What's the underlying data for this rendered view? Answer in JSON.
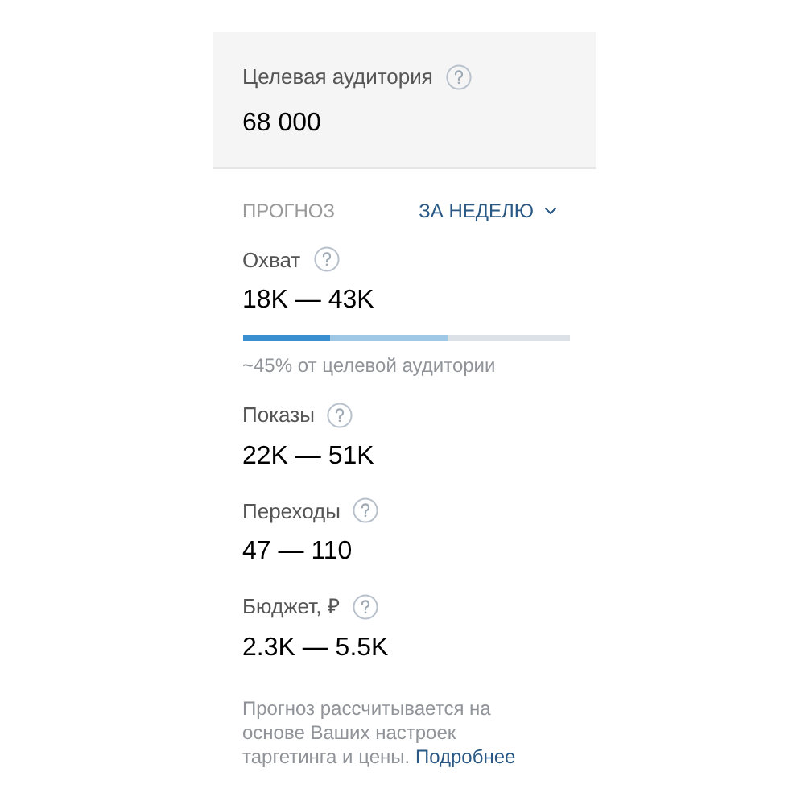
{
  "audience": {
    "label": "Целевая аудитория",
    "value": "68 000"
  },
  "forecast": {
    "title": "ПРОГНОЗ",
    "period": "ЗА НЕДЕЛЮ"
  },
  "metrics": [
    {
      "label": "Охват",
      "value": "18K — 43K",
      "kind": "bar",
      "bar": [
        {
          "level": 0.63
        },
        {
          "level": 0.27
        }
      ],
      "note": "~45% от целевой аудитории"
    },
    {
      "label": "Показы",
      "value": "22K — 51K",
      "kind": "plain"
    },
    {
      "label": "Переходы",
      "value": "47 — 110",
      "kind": "plain"
    },
    {
      "label": "Бюджет, ₽",
      "value": "2.3K — 5.5K",
      "kind": "plain"
    }
  ],
  "footnote": {
    "text": "Прогноз рассчитывается на основе Ваших настроек таргетинга и цены.",
    "link": "Подробнее"
  }
}
